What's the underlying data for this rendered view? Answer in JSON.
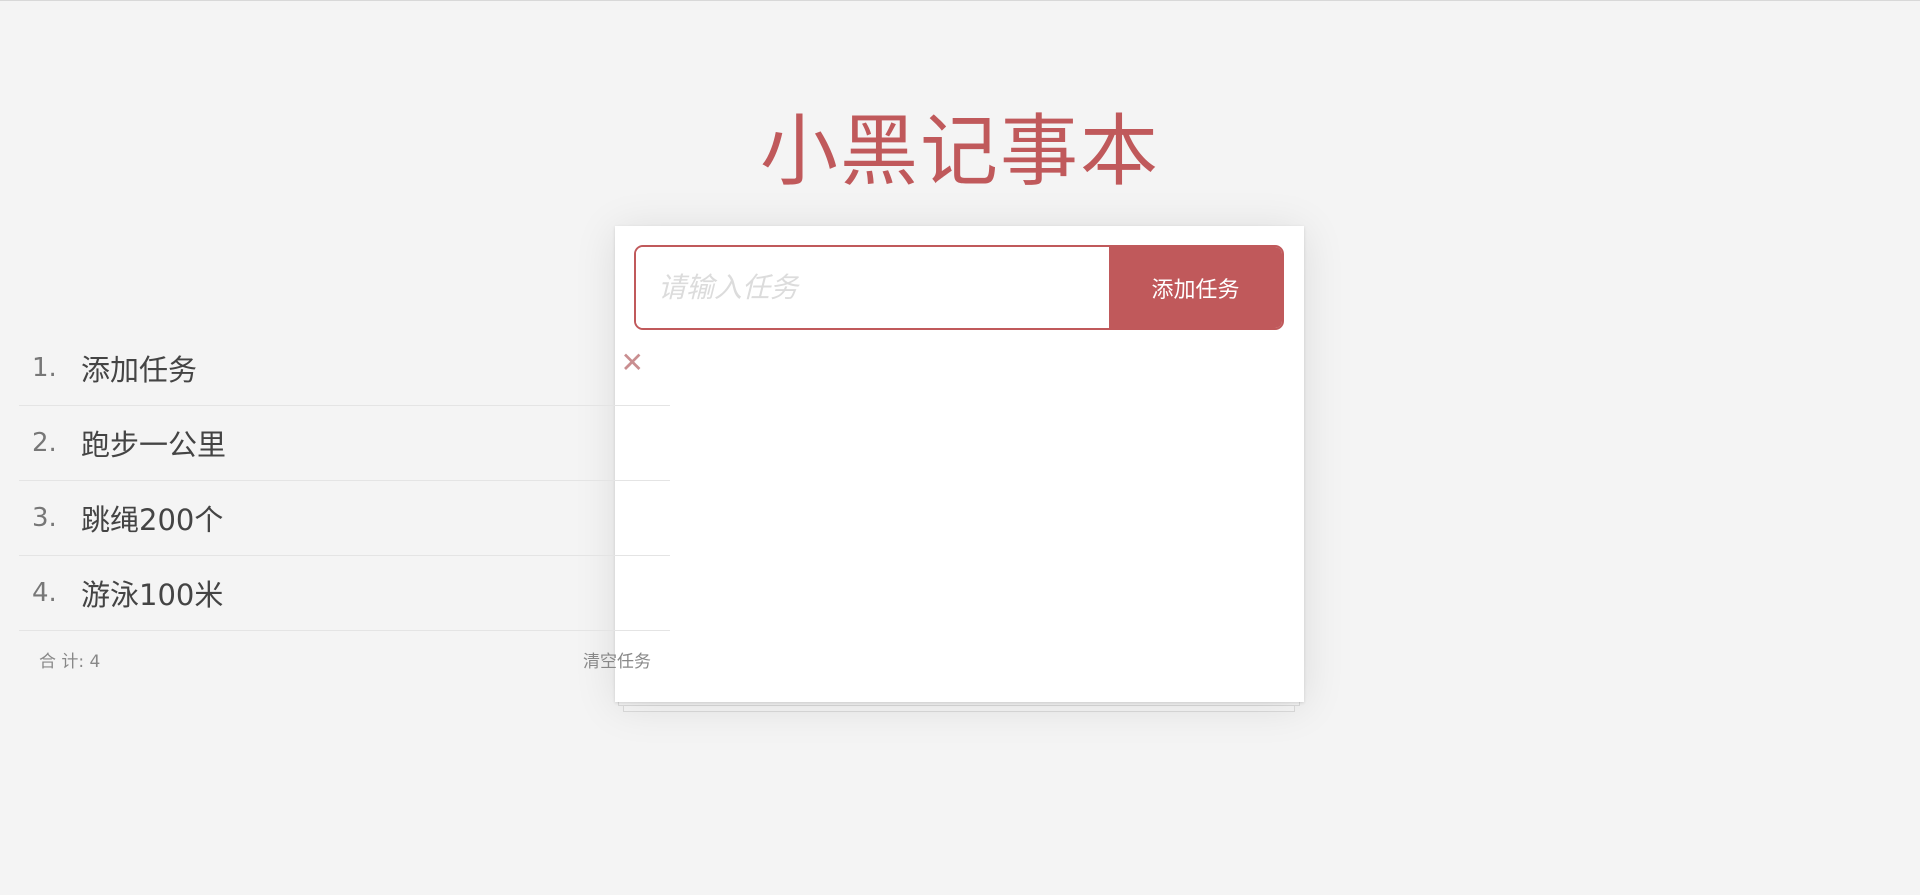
{
  "app": {
    "title": "小黑记事本"
  },
  "input": {
    "value": "",
    "placeholder": "请输入任务"
  },
  "add_button": {
    "label": "添加任务"
  },
  "todos": [
    {
      "index": "1.",
      "text": "添加任务"
    },
    {
      "index": "2.",
      "text": "跑步一公里"
    },
    {
      "index": "3.",
      "text": "跳绳200个"
    },
    {
      "index": "4.",
      "text": "游泳100米"
    }
  ],
  "delete_icon": {
    "glyph": "✕",
    "icon": "close-icon"
  },
  "footer": {
    "count_label": "合 计: 4",
    "clear_label": "清空任务"
  },
  "colors": {
    "accent": "#c0595b",
    "background": "#f4f4f4",
    "delete_icon": "#c98e90"
  }
}
